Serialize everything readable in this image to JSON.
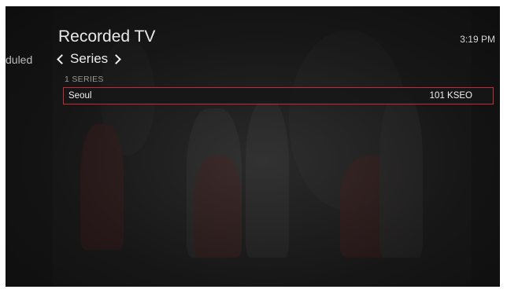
{
  "header": {
    "title": "Recorded TV",
    "clock": "3:19 PM"
  },
  "nav": {
    "prev_tab_partial": "duled",
    "current_tab": "Series"
  },
  "list": {
    "count_label": "1 SERIES",
    "items": [
      {
        "name": "Seoul",
        "channel": "101 KSEO",
        "selected": true
      }
    ]
  },
  "colors": {
    "selection_border": "#c42b34",
    "background": "#141414"
  }
}
